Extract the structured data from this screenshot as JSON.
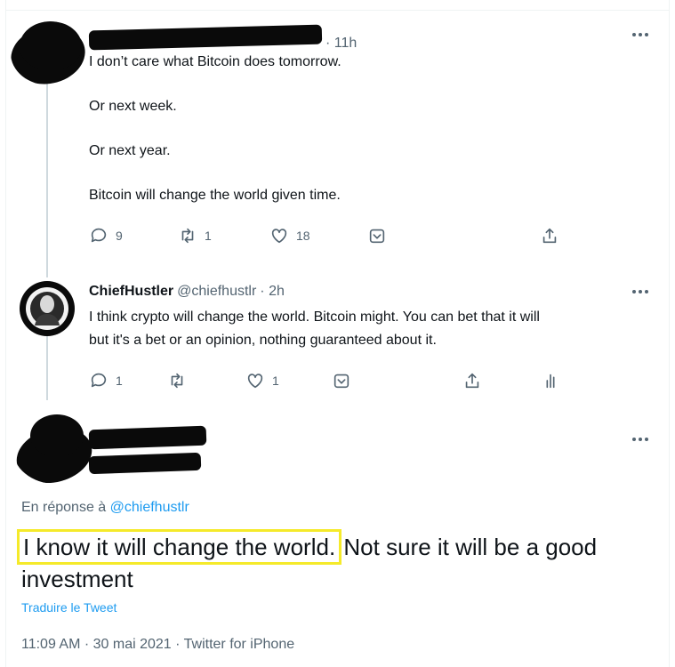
{
  "tweets": [
    {
      "name": "",
      "handle": "",
      "time": "· 11h",
      "lines": [
        "I don’t care what Bitcoin does tomorrow.",
        "Or next week.",
        "Or next year.",
        "Bitcoin will change the world given time."
      ],
      "replies": "9",
      "retweets": "1",
      "likes": "18"
    },
    {
      "name": "ChiefHustler",
      "handle": "@chiefhustlr",
      "time": "· 2h",
      "lines": [
        "I think crypto will change the world. Bitcoin might. You can bet that it will",
        "but it's a bet or an opinion, nothing guaranteed about it."
      ],
      "replies": "1",
      "retweets": "",
      "likes": "1"
    }
  ],
  "main": {
    "reply_prefix": "En réponse à",
    "reply_to": "@chiefhustlr",
    "text_highlight": "I know it will change the world.",
    "text_rest": " Not sure it will be a good investment",
    "translate": "Traduire le Tweet",
    "meta": "11:09 AM · 30 mai 2021 · Twitter for iPhone",
    "highlight_color": "#f5ea2a"
  },
  "icons": [
    "reply-icon",
    "retweet-icon",
    "like-icon",
    "dislike-icon",
    "share-icon",
    "analytics-icon",
    "more-icon"
  ]
}
